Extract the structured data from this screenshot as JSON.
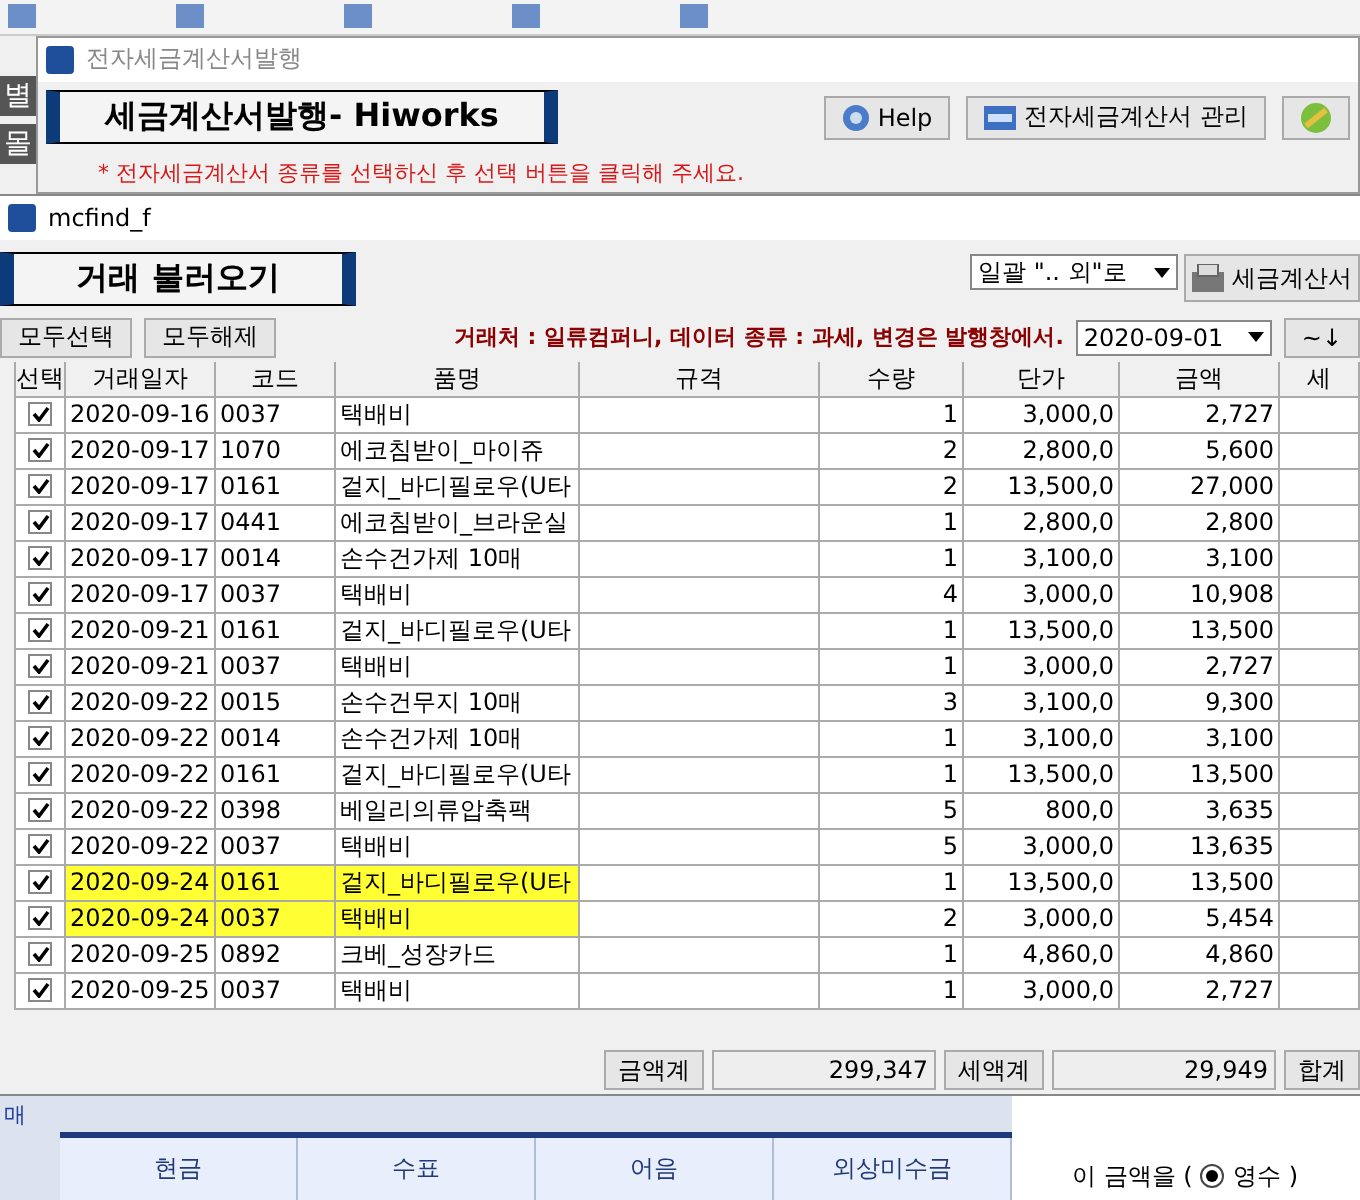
{
  "left_strip": [
    "별",
    "몰"
  ],
  "invoice_window": {
    "title": "전자세금계산서발행",
    "heading": "세금계산서발행- Hiworks",
    "buttons": [
      {
        "kind": "help",
        "label": "Help"
      },
      {
        "kind": "html",
        "label": "전자세금계산서 관리"
      },
      {
        "kind": "globe"
      }
    ],
    "notice": "* 전자세금계산서 종류를 선택하신 후 선택 버튼을 클릭해 주세요."
  },
  "find_window": {
    "title": "mcfind_f",
    "heading": "거래 불러오기",
    "mode_select": {
      "value": "일괄 \".. 외\"로"
    },
    "print_button": "세금계산서",
    "select_all": "모두선택",
    "deselect_all": "모두해제",
    "info": "거래처 : 일류컴퍼니, 데이터 종류 : 과세, 변경은 발행창에서.",
    "date_select": {
      "value": "2020-09-01"
    },
    "range_button": "~↓",
    "table": {
      "columns": [
        "선택",
        "거래일자",
        "코드",
        "품명",
        "규격",
        "수량",
        "단가",
        "금액",
        "세"
      ],
      "rows": [
        {
          "checked": true,
          "highlighted": false,
          "cells": [
            "",
            "2020-09-16",
            "0037",
            "택배비",
            "",
            "1",
            "3,000,0",
            "2,727",
            ""
          ]
        },
        {
          "checked": true,
          "highlighted": false,
          "cells": [
            "",
            "2020-09-17",
            "1070",
            "에코침받이_마이쥬",
            "",
            "2",
            "2,800,0",
            "5,600",
            ""
          ]
        },
        {
          "checked": true,
          "highlighted": false,
          "cells": [
            "",
            "2020-09-17",
            "0161",
            "겉지_바디필로우(U타",
            "",
            "2",
            "13,500,0",
            "27,000",
            ""
          ]
        },
        {
          "checked": true,
          "highlighted": false,
          "cells": [
            "",
            "2020-09-17",
            "0441",
            "에코침받이_브라운실",
            "",
            "1",
            "2,800,0",
            "2,800",
            ""
          ]
        },
        {
          "checked": true,
          "highlighted": false,
          "cells": [
            "",
            "2020-09-17",
            "0014",
            "손수건가제 10매",
            "",
            "1",
            "3,100,0",
            "3,100",
            ""
          ]
        },
        {
          "checked": true,
          "highlighted": false,
          "cells": [
            "",
            "2020-09-17",
            "0037",
            "택배비",
            "",
            "4",
            "3,000,0",
            "10,908",
            ""
          ]
        },
        {
          "checked": true,
          "highlighted": false,
          "cells": [
            "",
            "2020-09-21",
            "0161",
            "겉지_바디필로우(U타",
            "",
            "1",
            "13,500,0",
            "13,500",
            ""
          ]
        },
        {
          "checked": true,
          "highlighted": false,
          "cells": [
            "",
            "2020-09-21",
            "0037",
            "택배비",
            "",
            "1",
            "3,000,0",
            "2,727",
            ""
          ]
        },
        {
          "checked": true,
          "highlighted": false,
          "cells": [
            "",
            "2020-09-22",
            "0015",
            "손수건무지 10매",
            "",
            "3",
            "3,100,0",
            "9,300",
            ""
          ]
        },
        {
          "checked": true,
          "highlighted": false,
          "cells": [
            "",
            "2020-09-22",
            "0014",
            "손수건가제 10매",
            "",
            "1",
            "3,100,0",
            "3,100",
            ""
          ]
        },
        {
          "checked": true,
          "highlighted": false,
          "cells": [
            "",
            "2020-09-22",
            "0161",
            "겉지_바디필로우(U타",
            "",
            "1",
            "13,500,0",
            "13,500",
            ""
          ]
        },
        {
          "checked": true,
          "highlighted": false,
          "cells": [
            "",
            "2020-09-22",
            "0398",
            "베일리의류압축팩",
            "",
            "5",
            "800,0",
            "3,635",
            ""
          ]
        },
        {
          "checked": true,
          "highlighted": false,
          "cells": [
            "",
            "2020-09-22",
            "0037",
            "택배비",
            "",
            "5",
            "3,000,0",
            "13,635",
            ""
          ]
        },
        {
          "checked": true,
          "highlighted": true,
          "cells": [
            "",
            "2020-09-24",
            "0161",
            "겉지_바디필로우(U타",
            "",
            "1",
            "13,500,0",
            "13,500",
            ""
          ]
        },
        {
          "checked": true,
          "highlighted": true,
          "cells": [
            "",
            "2020-09-24",
            "0037",
            "택배비",
            "",
            "2",
            "3,000,0",
            "5,454",
            ""
          ]
        },
        {
          "checked": true,
          "highlighted": false,
          "cells": [
            "",
            "2020-09-25",
            "0892",
            "크베_성장카드",
            "",
            "1",
            "4,860,0",
            "4,860",
            ""
          ]
        },
        {
          "checked": true,
          "highlighted": false,
          "cells": [
            "",
            "2020-09-25",
            "0037",
            "택배비",
            "",
            "1",
            "3,000,0",
            "2,727",
            ""
          ]
        }
      ]
    },
    "totals": [
      {
        "label": "금액계",
        "value": "299,347"
      },
      {
        "label": "세액계",
        "value": "29,949"
      },
      {
        "label": "합계"
      }
    ]
  },
  "payment_panel": {
    "side_label": "매",
    "columns": [
      "현금",
      "수표",
      "어음",
      "외상미수금"
    ],
    "receipt": {
      "prefix": "이 금액을 (",
      "options": [
        {
          "label": "영수",
          "selected": true
        }
      ],
      "suffix": ")"
    }
  }
}
